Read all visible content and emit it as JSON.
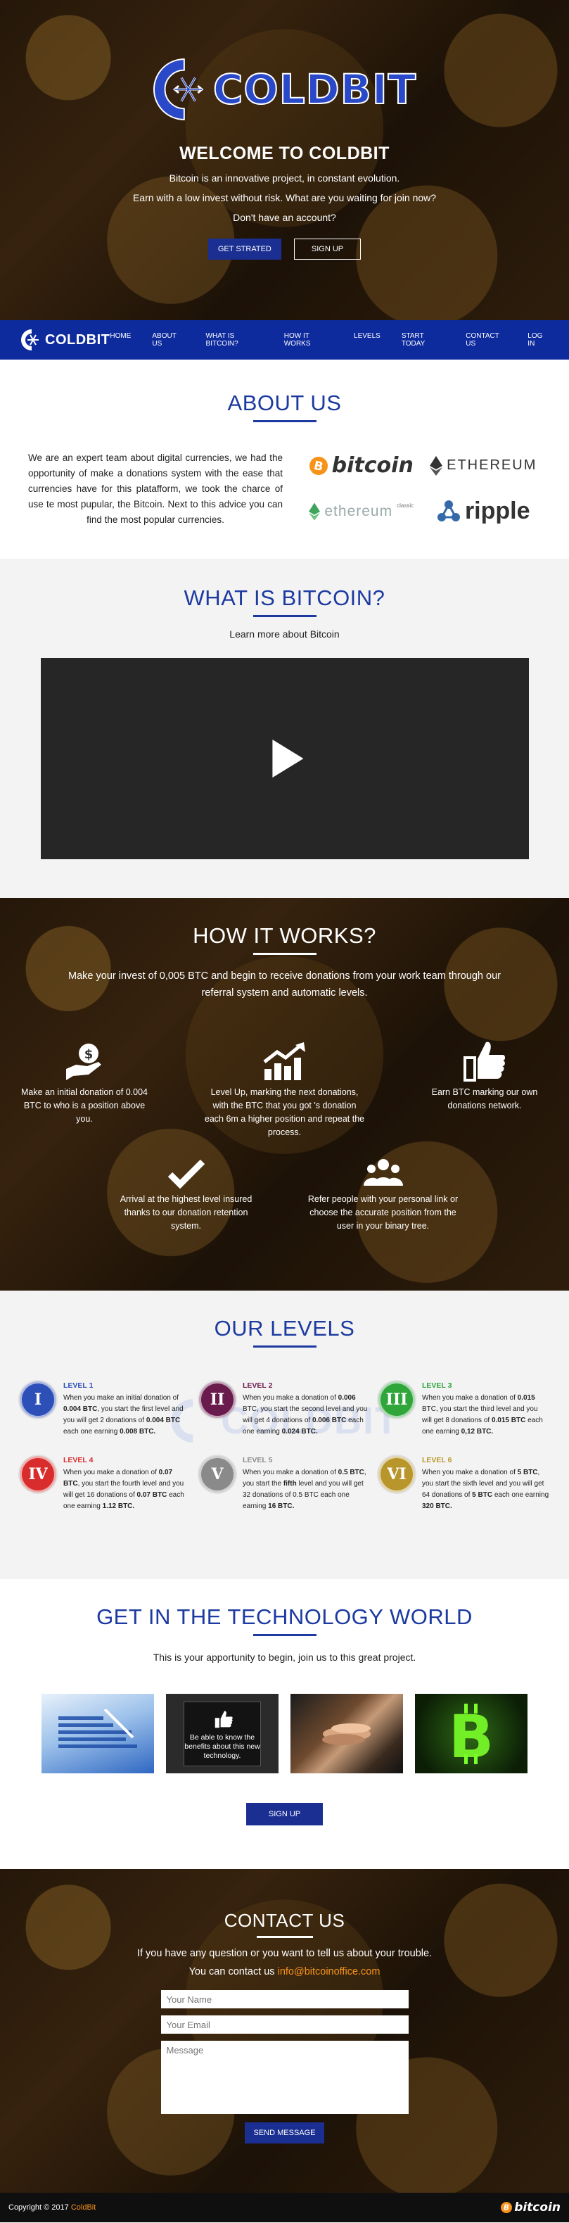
{
  "hero": {
    "logo_text": "COLDBIT",
    "title": "WELCOME TO COLDBIT",
    "line1": "Bitcoin is an innovative project, in constant evolution.",
    "line2": "Earn with a low invest without risk. What are you waiting for join now?",
    "line3": "Don't have an account?",
    "btn_start": "GET STRATED",
    "btn_signup": "SIGN UP"
  },
  "nav": {
    "logo_text": "COLDBIT",
    "items": [
      "HOME",
      "ABOUT US",
      "WHAT IS BITCOIN?",
      "HOW IT WORKS",
      "LEVELS",
      "START TODAY",
      "CONTACT US",
      "LOG IN"
    ]
  },
  "about": {
    "title": "ABOUT US",
    "text": "We are an expert team about digital currencies, we had the opportunity of make a donations system with the ease that currencies have for this platafform, we took the charce of use te most pupular, the Bitcoin. Next to this advice you can find the most popular currencies.",
    "brands": {
      "bitcoin": "bitcoin",
      "ethereum": "ETHEREUM",
      "ethereum_classic": "ethereum",
      "ethereum_classic_tag": "classic",
      "ripple": "ripple"
    }
  },
  "what": {
    "title": "WHAT IS BITCOIN?",
    "subtitle": "Learn more about Bitcoin"
  },
  "how": {
    "title": "HOW IT WORKS?",
    "intro": "Make your invest of 0,005 BTC and begin to receive donations from your work team through our referral system and automatic levels.",
    "steps": [
      {
        "icon": "money-hand-icon",
        "text": "Make an initial donation of 0.004 BTC to who is a position above you."
      },
      {
        "icon": "growth-chart-icon",
        "text": "Level Up, marking the next donations, with the BTC that you got 's donation each 6m a higher position and repeat the process."
      },
      {
        "icon": "thumbs-up-icon",
        "text": "Earn BTC marking our own donations network."
      },
      {
        "icon": "checkmark-icon",
        "text": "Arrival at the highest level insured thanks to our donation retention system."
      },
      {
        "icon": "users-icon",
        "text": "Refer people with your personal link or choose the accurate position from the user in your binary tree."
      }
    ]
  },
  "levels": {
    "title": "OUR LEVELS",
    "watermark": "COLDBIT",
    "items": [
      {
        "numeral": "I",
        "label": "LEVEL 1",
        "color": "#2d4fb8",
        "pre": "When you make an initial donation of ",
        "b1": "0.004 BTC",
        "mid": ", you start the first level and you will get 2 donations of ",
        "b2": "0.004 BTC",
        "post": " each one earning ",
        "b3": "0.008 BTC."
      },
      {
        "numeral": "II",
        "label": "LEVEL 2",
        "color": "#6a1b4d",
        "pre": "When you make a donation of ",
        "b1": "0.006",
        "mid": " BTC, you start the second level and you will get 4 donations of ",
        "b2": "0.006 BTC",
        "post": " each one earning ",
        "b3": "0.024 BTC."
      },
      {
        "numeral": "III",
        "label": "LEVEL 3",
        "color": "#2fa53a",
        "pre": "When you make a donation of ",
        "b1": "0.015",
        "mid": " BTC, you start the third level and you will get 8 donations of ",
        "b2": "0.015 BTC",
        "post": " each one earning ",
        "b3": "0,12 BTC."
      },
      {
        "numeral": "IV",
        "label": "LEVEL 4",
        "color": "#d92c2c",
        "pre": "When you make a donation of ",
        "b1": "0.07 BTC",
        "mid": ", you start the fourth level and you will get 16 donations of ",
        "b2": "0.07 BTC",
        "post": " each one earning ",
        "b3": "1.12 BTC."
      },
      {
        "numeral": "V",
        "label": "LEVEL 5",
        "color": "#8a8a8a",
        "pre": "When you make a donation of ",
        "b1": "0.5 BTC",
        "mid": ", you start the ",
        "b2": "fifth",
        "post": " level and you will get 32 donations of 0.5 BTC each one earning ",
        "b3": "16 BTC."
      },
      {
        "numeral": "VI",
        "label": "LEVEL 6",
        "color": "#b8962c",
        "pre": "When you make a donation of ",
        "b1": "5 BTC",
        "mid": ", you start the sixth level and you will get 64 donations of ",
        "b2": "5 BTC",
        "post": " each one earning ",
        "b3": "320 BTC."
      }
    ]
  },
  "tech": {
    "title": "GET IN THE TECHNOLOGY WORLD",
    "intro": "This is your apportunity to begin, join us to this great project.",
    "card_text": "Be able to know the benefits about this new technology.",
    "btn_signup": "SIGN UP"
  },
  "contact": {
    "title": "CONTACT US",
    "line1": "If you have any question or you want to tell us about your trouble.",
    "line2_prefix": "You can contact us ",
    "email": "info@bitcoinoffice.com",
    "name_placeholder": "Your Name",
    "email_placeholder": "Your Email",
    "message_placeholder": "Message",
    "btn_send": "SEND MESSAGE"
  },
  "footer": {
    "copyright": "Copyright © 2017 ",
    "brand": "ColdBit",
    "btc_logo_text": "bitcoin"
  },
  "colors": {
    "brand_blue": "#0e2b9e",
    "title_blue": "#1c3aa0",
    "bitcoin_orange": "#f7931a"
  }
}
